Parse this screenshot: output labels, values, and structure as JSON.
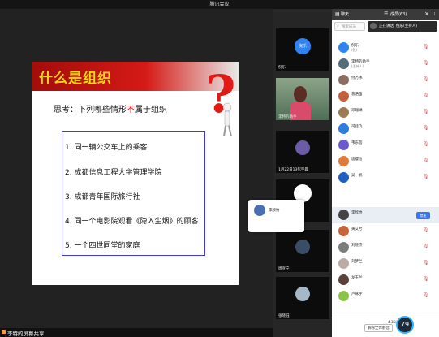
{
  "app": {
    "title": "腾讯会议"
  },
  "slide": {
    "title": "什么是组织",
    "question_prefix": "思考：下列哪些情形",
    "question_red": "不",
    "question_suffix": "属于组织",
    "items": [
      "1. 同一辆公交车上的乘客",
      "2. 成都信息工程大学管理学院",
      "3. 成都青年国际旅行社",
      "4. 同一个电影院观看《隐入尘烟》的顾客",
      "5. 一个四世同堂的家庭"
    ]
  },
  "share_status": {
    "text": "李特的屏幕共享"
  },
  "video_tiles": [
    {
      "name": "倪乐",
      "avatar_text": "倪乐"
    },
    {
      "name": "李特的助手"
    },
    {
      "name": "1月22日13彭宇晨"
    },
    {
      "name": ""
    },
    {
      "name": "周宣宁"
    },
    {
      "name": "张晓钰"
    }
  ],
  "sidebar": {
    "tabs": [
      "聊天",
      "成员(63)"
    ],
    "search_placeholder": "搜索成员",
    "speaking": "正在讲话: 倪乐(主持人)",
    "members": [
      {
        "name": "倪乐",
        "sub": "(我)",
        "color": "#2f83f5"
      },
      {
        "name": "李特的助手",
        "sub": "(主持人)",
        "color": "#546e7a"
      },
      {
        "name": "付万伟",
        "sub": "",
        "color": "#8d6e63"
      },
      {
        "name": "曹浩笛",
        "sub": "",
        "color": "#c45f3b"
      },
      {
        "name": "邓瑞琳",
        "sub": "",
        "color": "#9e7b55"
      },
      {
        "name": "司徒飞",
        "sub": "",
        "color": "#2d7de0"
      },
      {
        "name": "韦东蓓",
        "sub": "",
        "color": "#6a5acd"
      },
      {
        "name": "唐樱怡",
        "sub": "",
        "color": "#e07a3a"
      },
      {
        "name": "吴一帆",
        "sub": "",
        "color": "#1f5fbf"
      },
      {
        "name": "李欣怡",
        "sub": "",
        "color": "#444"
      },
      {
        "name": "黄艾兮",
        "sub": "",
        "color": "#c4663a"
      },
      {
        "name": "刘晓杰",
        "sub": "",
        "color": "#7c7c7c"
      },
      {
        "name": "刘梦兰",
        "sub": "",
        "color": "#bcaaa4"
      },
      {
        "name": "龙玉兰",
        "sub": "",
        "color": "#5d4037"
      },
      {
        "name": "卢咏宇",
        "sub": "",
        "color": "#8bc34a"
      }
    ],
    "mute_label": "禁麦",
    "mute_all_label": "解除全体静音",
    "net_stats": "4.3K/s"
  },
  "popup": {
    "name": "李欣怡"
  },
  "gauge": {
    "value": "79"
  }
}
